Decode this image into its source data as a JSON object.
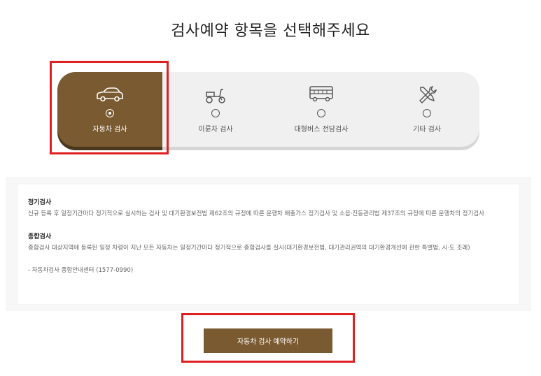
{
  "page": {
    "title": "검사예약 항목을 선택해주세요"
  },
  "tabs": [
    {
      "label": "자동차 검사",
      "icon": "car-icon",
      "selected": true
    },
    {
      "label": "이륜차 검사",
      "icon": "motorcycle-icon",
      "selected": false
    },
    {
      "label": "대형버스 전담검사",
      "icon": "bus-icon",
      "selected": false
    },
    {
      "label": "기타 검사",
      "icon": "tools-icon",
      "selected": false
    }
  ],
  "info": {
    "section1_title": "정기검사",
    "section1_text": "신규 등록 후 일정기간마다 정기적으로 실시하는 검사 및 대기환경보전법 제62조의 규정에 따른 운행차 배출가스 정기검사 및 소음·진동관리법 제37조의 규정에 따른 운행차의 정기검사",
    "section2_title": "종합검사",
    "section2_text": "종합검사 대상지역에 등록된 일정 차령이 지난 모든 자동차는 일정기간마다 정기적으로 종합검사를 실시(대기환경보전법, 대기관리권역의 대기환경개선에 관한 특별법, 시·도 조례)",
    "contact": "- 자동차검사 종합안내센터 (1577-0990)"
  },
  "cta": {
    "label": "자동차 검사 예약하기"
  },
  "colors": {
    "accent": "#7a5a30",
    "highlight": "#e02020"
  }
}
